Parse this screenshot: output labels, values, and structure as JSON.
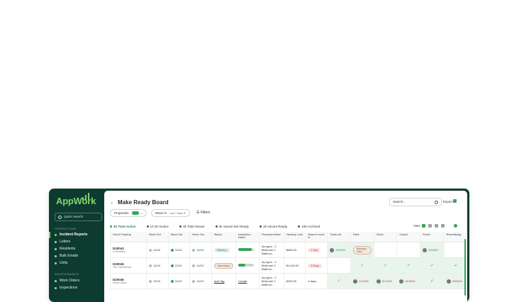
{
  "app": {
    "logo": "AppWork"
  },
  "sidebar": {
    "quick_search": "Quick Search",
    "sections": [
      {
        "label": "OPERATIONS"
      },
      {
        "label": "MAINTENANCE"
      }
    ],
    "items": [
      {
        "label": "Incident Reports",
        "active": true
      },
      {
        "label": "Letters"
      },
      {
        "label": "Residents"
      },
      {
        "label": "Bulk Emails"
      },
      {
        "label": "Units"
      },
      {
        "label": "Work Orders"
      },
      {
        "label": "Inspections"
      }
    ]
  },
  "header": {
    "title": "Make Ready Board",
    "search_placeholder": "Search...",
    "export_label": "Export"
  },
  "filters": {
    "properties": "Properties",
    "properties_count": "10",
    "move_in": "Move In",
    "move_in_sub": "Last 7 Days",
    "filters_label": "Filters"
  },
  "stats": [
    "4k Total Active",
    "10 On Notice",
    "3k Total Vacant",
    "3k Vacant Not Ready",
    "3k Vacant Ready",
    "10k Archived"
  ],
  "view": {
    "label": "View"
  },
  "table": {
    "columns": [
      "Unit & Property",
      "Move Out",
      "Move Out",
      "Move Out",
      "Status",
      "Inspection Name",
      "Floorplan Name",
      "Vacancy Loss",
      "Days to move in",
      "Trash out",
      "Paint",
      "Clean",
      "Carpet",
      "Punch",
      "Resurfacing"
    ],
    "rows": [
      {
        "unit": "D20043",
        "property": "Le Bordeau",
        "move_out": [
          "11/24",
          "11/24",
          "11/24"
        ],
        "status": "Delivery",
        "status_style": "green",
        "inspection": "",
        "inspection_progress": 0.85,
        "floorplan": "Ay-ngon - 2 Bedroom 2 Bathroo...",
        "vacancy_loss": "$695.03",
        "days": "1 Day",
        "days_style": "red",
        "trash_out": "10/30/24",
        "paint": "Manage Task",
        "clean": "",
        "carpet": "",
        "punch": "12/16/21",
        "resurfacing": ""
      },
      {
        "unit": "D20045",
        "property": "The Greenhouse",
        "move_out": [
          "11/24",
          "11/24",
          "11/24"
        ],
        "status": "Standards",
        "status_style": "tan",
        "inspection": "",
        "inspection_progress": 0.45,
        "floorplan": "Ay-ngon - 2 Bedroom 2 Bathroo...",
        "vacancy_loss": "$1,440.00",
        "days": "8 Days",
        "days_style": "red",
        "trash_out": "",
        "paint": "✓",
        "clean": "✓",
        "carpet": "✓",
        "punch": "✓",
        "resurfacing": "✓"
      },
      {
        "unit": "D20046",
        "property": "Urban Oasis",
        "move_out": [
          "11/24",
          "11/24",
          "11/24"
        ],
        "status": "Add Tag",
        "status_style": "link",
        "inspection": "Create",
        "inspection_progress": null,
        "floorplan": "Ay-ngon - 2 Bedroom 2 Bathroo...",
        "vacancy_loss": "$225.00",
        "days": "6 days",
        "days_style": "plain",
        "trash_out": "✓",
        "paint": "12/16/26",
        "clean": "01/18/25",
        "carpet": "05/18/25",
        "punch": "✓",
        "resurfacing": "06/05/26"
      }
    ]
  },
  "colors": {
    "sidebar": "#0e3b30",
    "accent": "#3aa35c",
    "logo": "#7fd36b"
  }
}
